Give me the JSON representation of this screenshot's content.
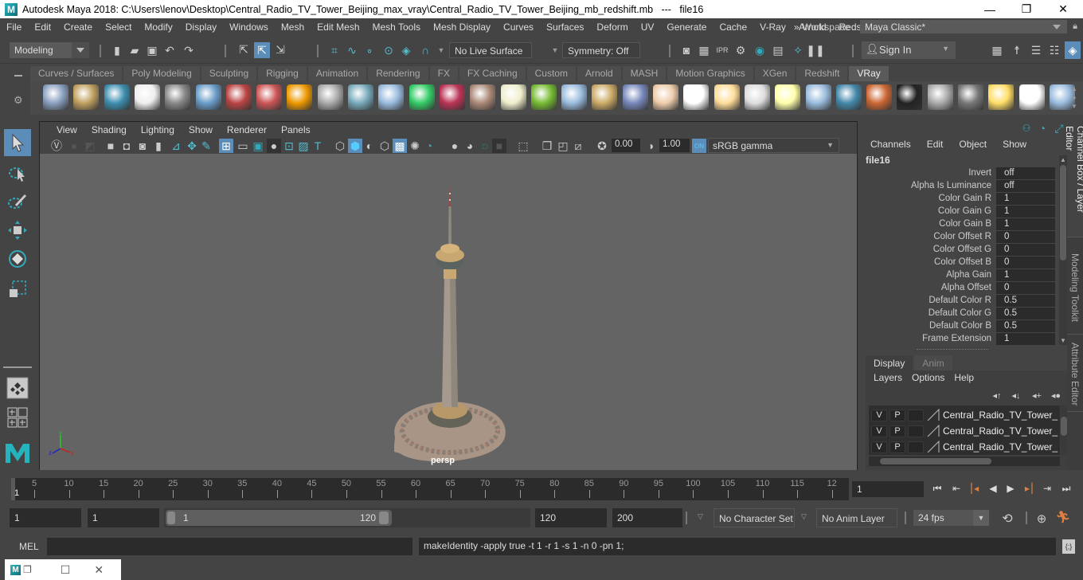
{
  "window": {
    "title": "Autodesk Maya 2018: C:\\Users\\lenov\\Desktop\\Central_Radio_TV_Tower_Beijing_max_vray\\Central_Radio_TV_Tower_Beijing_mb_redshift.mb   ---   file16",
    "logo": "M",
    "minimize": "—",
    "restore": "❐",
    "close": "✕"
  },
  "menubar": {
    "items": [
      "File",
      "Edit",
      "Create",
      "Select",
      "Modify",
      "Display",
      "Windows",
      "Mesh",
      "Edit Mesh",
      "Mesh Tools",
      "Mesh Display",
      "Curves",
      "Surfaces",
      "Deform",
      "UV",
      "Generate",
      "Cache",
      "V-Ray",
      "Arnold",
      "Redshift"
    ],
    "overflow": "»",
    "workspace_label": "Workspace :",
    "workspace_value": "Maya Classic*"
  },
  "statusline": {
    "mode": "Modeling",
    "live_surface": "No Live Surface",
    "symmetry": "Symmetry: Off",
    "sign_in": "Sign In"
  },
  "shelf": {
    "tabs": [
      "Curves / Surfaces",
      "Poly Modeling",
      "Sculpting",
      "Rigging",
      "Animation",
      "Rendering",
      "FX",
      "FX Caching",
      "Custom",
      "Arnold",
      "MASH",
      "Motion Graphics",
      "XGen",
      "Redshift",
      "VRay"
    ],
    "active_tab": "VRay",
    "icons": [
      "vray-save-icon",
      "vray-load-icon",
      "vray-list-icon",
      "vray-logo-icon",
      "vray-doc-icon",
      "vray-mtl-icon",
      "vray-camera-icon",
      "vray-spheres-icon",
      "vray-fire-icon",
      "vray-mesh-icon",
      "vray-proxy-icon",
      "vray-cone-icon",
      "vray-fog-icon",
      "vray-scene-icon",
      "vray-texture-icon",
      "vray-sphere-light-icon",
      "vray-grass-icon",
      "vray-fur-icon",
      "vray-curve-icon",
      "vray-globe-icon",
      "vray-dome-light-icon",
      "vray-spot-light-icon",
      "vray-omni-light-icon",
      "vray-ies-light-icon",
      "vray-sun-icon",
      "vray-plane-icon",
      "vray-blue-sphere-icon",
      "vray-multi-icon",
      "vray-checker-icon",
      "vray-frame-buffer-icon",
      "vray-settings-icon",
      "vray-light-lister-icon",
      "vray-cloud-icon",
      "vray-help-icon"
    ]
  },
  "viewport": {
    "menu": [
      "View",
      "Shading",
      "Lighting",
      "Show",
      "Renderer",
      "Panels"
    ],
    "exposure": "0.00",
    "gamma": "1.00",
    "color_space": "sRGB gamma",
    "camera_label": "persp",
    "axis": {
      "x": "x",
      "y": "y",
      "z": "z"
    }
  },
  "channel_box": {
    "menu": [
      "Channels",
      "Edit",
      "Object",
      "Show"
    ],
    "node": "file16",
    "attributes": [
      {
        "label": "Invert",
        "value": "off"
      },
      {
        "label": "Alpha Is Luminance",
        "value": "off"
      },
      {
        "label": "Color Gain R",
        "value": "1"
      },
      {
        "label": "Color Gain G",
        "value": "1"
      },
      {
        "label": "Color Gain B",
        "value": "1"
      },
      {
        "label": "Color Offset R",
        "value": "0"
      },
      {
        "label": "Color Offset G",
        "value": "0"
      },
      {
        "label": "Color Offset B",
        "value": "0"
      },
      {
        "label": "Alpha Gain",
        "value": "1"
      },
      {
        "label": "Alpha Offset",
        "value": "0"
      },
      {
        "label": "Default Color R",
        "value": "0.5"
      },
      {
        "label": "Default Color G",
        "value": "0.5"
      },
      {
        "label": "Default Color B",
        "value": "0.5"
      },
      {
        "label": "Frame Extension",
        "value": "1"
      }
    ]
  },
  "layer_editor": {
    "tabs": [
      "Display",
      "Anim"
    ],
    "active_tab": "Display",
    "menu": [
      "Layers",
      "Options",
      "Help"
    ],
    "layers": [
      {
        "v": "V",
        "p": "P",
        "name": "Central_Radio_TV_Tower_Be"
      },
      {
        "v": "V",
        "p": "P",
        "name": "Central_Radio_TV_Tower_Be"
      },
      {
        "v": "V",
        "p": "P",
        "name": "Central_Radio_TV_Tower_Be"
      }
    ]
  },
  "side_tabs": [
    "Channel Box / Layer Editor",
    "Modeling Toolkit",
    "Attribute Editor"
  ],
  "timeline": {
    "ticks": [
      "5",
      "10",
      "15",
      "20",
      "25",
      "30",
      "35",
      "40",
      "45",
      "50",
      "55",
      "60",
      "65",
      "70",
      "75",
      "80",
      "85",
      "90",
      "95",
      "100",
      "105",
      "110",
      "115",
      "12"
    ],
    "current_frame_marker": "1",
    "current_frame": "1"
  },
  "range": {
    "start": "1",
    "playback_start": "1",
    "slider_start": "1",
    "slider_end": "120",
    "playback_end": "120",
    "end": "200",
    "character_set": "No Character Set",
    "anim_layer": "No Anim Layer",
    "fps": "24 fps"
  },
  "command_line": {
    "language": "MEL",
    "input": "",
    "result": "makeIdentity -apply true -t 1 -r 1 -s 1 -n 0 -pn 1;"
  },
  "taskbar": {
    "logo": "M"
  }
}
